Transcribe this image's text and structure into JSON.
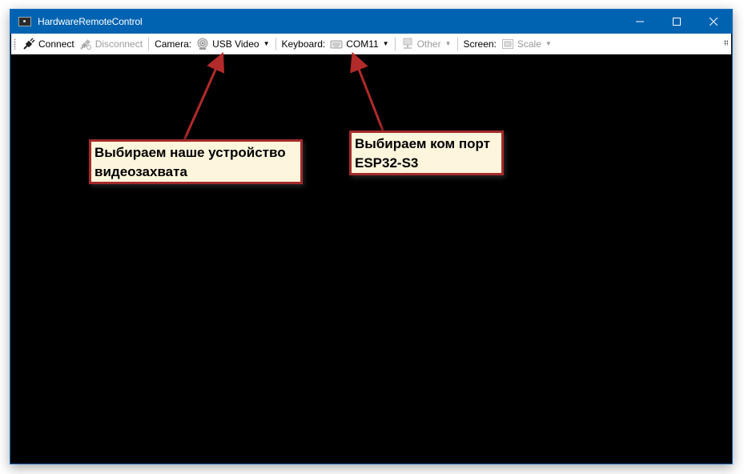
{
  "window": {
    "title": "HardwareRemoteControl",
    "controls": {
      "minimize": "—",
      "maximize": "☐",
      "close": "✕"
    }
  },
  "toolbar": {
    "connect_label": "Connect",
    "disconnect_label": "Disconnect",
    "camera_label": "Camera:",
    "camera_value": "USB Video",
    "keyboard_label": "Keyboard:",
    "keyboard_value": "COM11",
    "other_label": "Other",
    "screen_label": "Screen:",
    "scale_label": "Scale",
    "icons": {
      "connect": "plug-icon",
      "disconnect": "unplug-icon",
      "camera": "webcam-icon",
      "keyboard": "keyboard-icon",
      "other": "monitor-icon",
      "scale": "scale-icon"
    }
  },
  "annotations": [
    {
      "text_line1": "Выбираем наше устройство",
      "text_line2": "видеозахвата"
    },
    {
      "text_line1": "Выбираем ком порт",
      "text_line2": "ESP32-S3"
    }
  ],
  "colors": {
    "titlebar": "#0063b1",
    "callout_border": "#a52a2a",
    "callout_bg": "#fdf5dc",
    "arrow": "#b22a2a",
    "viewport": "#000000"
  }
}
